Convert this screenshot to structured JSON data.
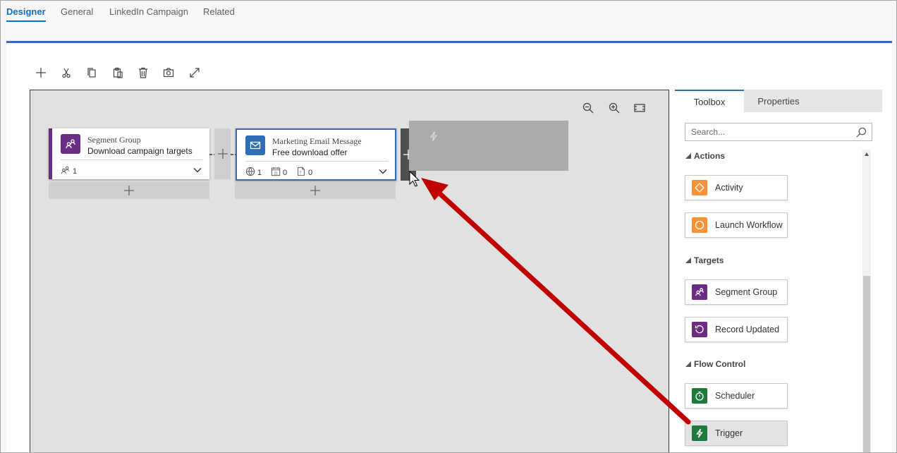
{
  "tabs": [
    {
      "label": "Designer"
    },
    {
      "label": "General"
    },
    {
      "label": "LinkedIn Campaign"
    },
    {
      "label": "Related"
    }
  ],
  "toolbar": {
    "icons": [
      "add-icon",
      "cut-icon",
      "copy-icon",
      "paste-icon",
      "delete-icon",
      "screenshot-icon",
      "expand-icon"
    ]
  },
  "canvas": {
    "zoom_controls": [
      "zoom-out-icon",
      "zoom-in-icon",
      "fit-to-screen-icon"
    ],
    "tiles": [
      {
        "type": "Segment Group",
        "name": "Download campaign targets",
        "accent": "#6b2d82",
        "meta": [
          {
            "icon": "segment-members-icon",
            "value": "1"
          }
        ]
      },
      {
        "type": "Marketing Email Message",
        "name": "Free download offer",
        "accent": "#2d6fb6",
        "meta": [
          {
            "icon": "globe-icon",
            "value": "1"
          },
          {
            "icon": "calendar-icon",
            "value": "0"
          },
          {
            "icon": "document-icon",
            "value": "0"
          }
        ]
      }
    ],
    "placeholder_icon": "trigger-icon"
  },
  "toolbox": {
    "tabs": [
      {
        "label": "Toolbox"
      },
      {
        "label": "Properties"
      }
    ],
    "search_placeholder": "Search...",
    "sections": [
      {
        "label": "Actions",
        "items": [
          {
            "label": "Activity",
            "icon": "diamond-icon",
            "color": "#f7923a"
          },
          {
            "label": "Launch Workflow",
            "icon": "circle-icon",
            "color": "#f7923a"
          }
        ]
      },
      {
        "label": "Targets",
        "items": [
          {
            "label": "Segment Group",
            "icon": "segment-icon",
            "color": "#6b2d82"
          },
          {
            "label": "Record Updated",
            "icon": "refresh-icon",
            "color": "#6b2d82"
          }
        ]
      },
      {
        "label": "Flow Control",
        "items": [
          {
            "label": "Scheduler",
            "icon": "timer-icon",
            "color": "#217a3d"
          },
          {
            "label": "Trigger",
            "icon": "trigger-icon",
            "color": "#217a3d"
          }
        ]
      }
    ]
  },
  "colors": {
    "accent_blue": "#2d6fb6",
    "annotation_arrow": "#c00000"
  }
}
